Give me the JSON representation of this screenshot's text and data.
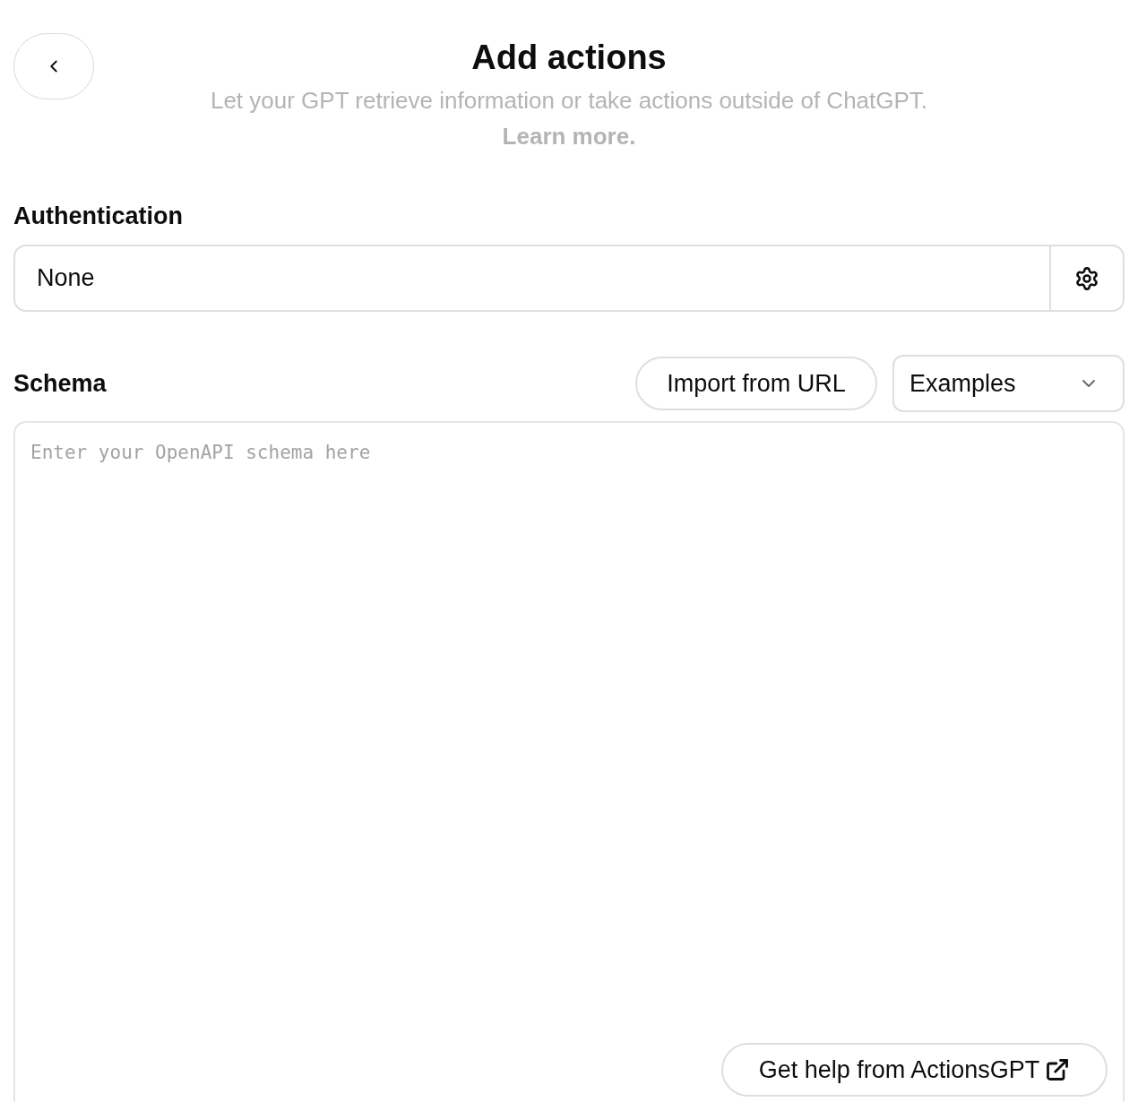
{
  "header": {
    "title": "Add actions",
    "subtitle": "Let your GPT retrieve information or take actions outside of ChatGPT.",
    "link": "Learn more."
  },
  "authentication": {
    "label": "Authentication",
    "value": "None"
  },
  "schema": {
    "label": "Schema",
    "import_button": "Import from URL",
    "examples_select": "Examples",
    "placeholder": "Enter your OpenAPI schema here",
    "help_button": "Get help from ActionsGPT"
  }
}
